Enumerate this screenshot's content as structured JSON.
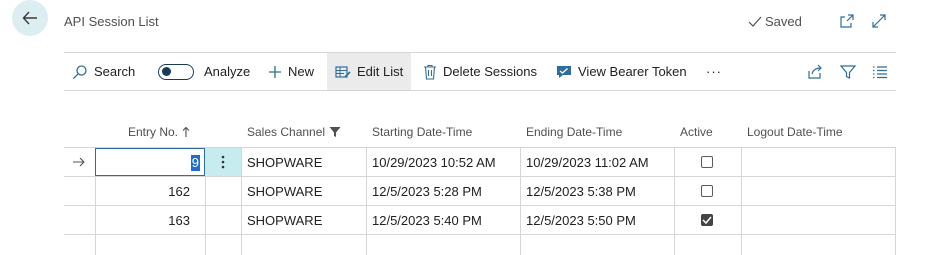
{
  "header": {
    "title": "API Session List",
    "saved_label": "Saved"
  },
  "actions": {
    "search": "Search",
    "analyze": "Analyze",
    "new": "New",
    "edit_list": "Edit List",
    "delete_sessions": "Delete Sessions",
    "view_bearer_token": "View Bearer Token",
    "more": "···"
  },
  "columns": {
    "entry_no": "Entry No.",
    "sales_channel": "Sales Channel",
    "starting": "Starting Date-Time",
    "ending": "Ending Date-Time",
    "active": "Active",
    "logout": "Logout Date-Time"
  },
  "rows": [
    {
      "entry_no": "9",
      "sales_channel": "SHOPWARE",
      "starting": "10/29/2023 10:52 AM",
      "ending": "10/29/2023 11:02 AM",
      "active": false,
      "logout": ""
    },
    {
      "entry_no": "162",
      "sales_channel": "SHOPWARE",
      "starting": "12/5/2023 5:28 PM",
      "ending": "12/5/2023 5:38 PM",
      "active": false,
      "logout": ""
    },
    {
      "entry_no": "163",
      "sales_channel": "SHOPWARE",
      "starting": "12/5/2023 5:40 PM",
      "ending": "12/5/2023 5:50 PM",
      "active": true,
      "logout": ""
    }
  ],
  "colors": {
    "accent": "#1a3a5c",
    "selection": "#1f6fd1",
    "selected_row_cell": "#c7ecef",
    "back_button_bg": "#dceef1"
  }
}
